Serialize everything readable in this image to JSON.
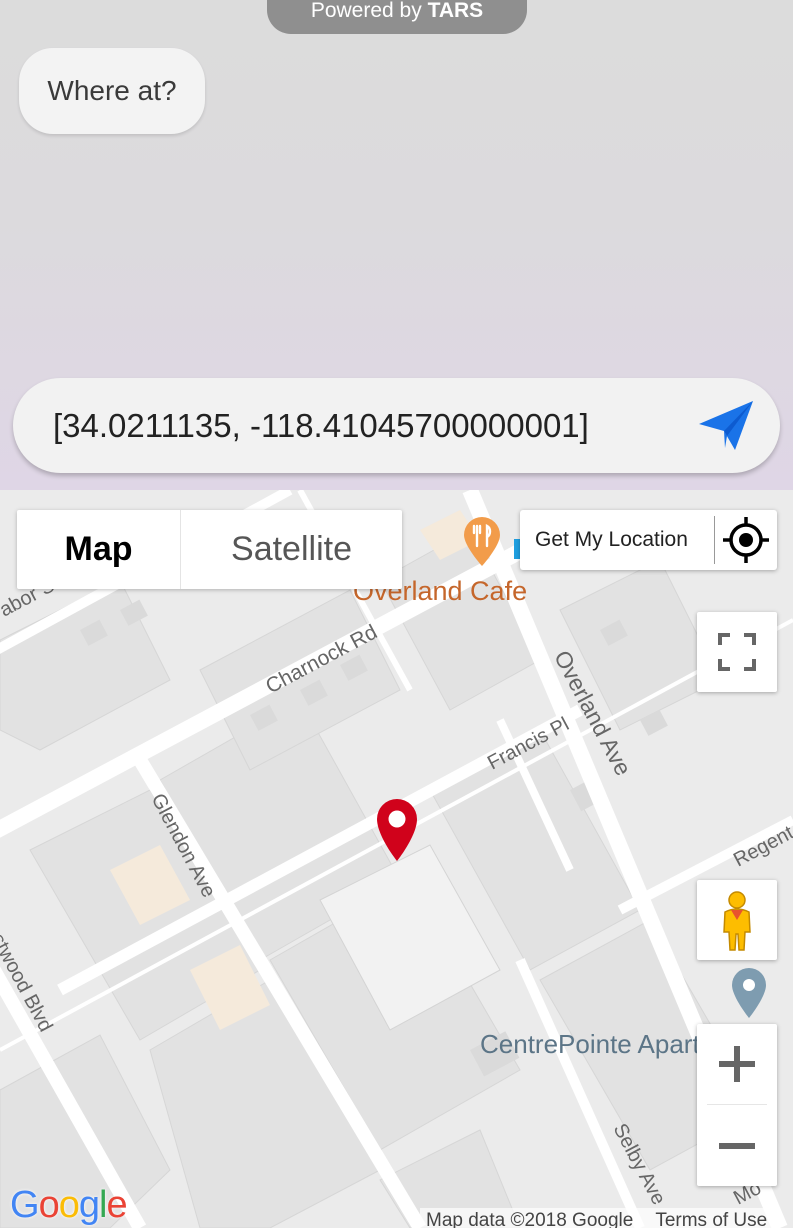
{
  "header": {
    "powered_prefix": "Powered by ",
    "powered_brand": "TARS"
  },
  "chat": {
    "bot_message": "Where at?"
  },
  "composer": {
    "value": "[34.0211135, -118.41045700000001]",
    "send_icon": "send-icon"
  },
  "map": {
    "type_control": {
      "map_label": "Map",
      "satellite_label": "Satellite",
      "selected": "Map"
    },
    "get_location_label": "Get My Location",
    "streets": {
      "tabor": "abor St",
      "charnock": "Charnock Rd",
      "overland": "Overland Ave",
      "francis": "Francis Pl",
      "glendon": "Glendon Ave",
      "regent": "Regent S",
      "westwood": "stwood Blvd",
      "selby": "Selby Ave",
      "mo": "Mo"
    },
    "places": {
      "cafe": "Overland Cafe",
      "apartments": "CentrePointe Apartments"
    },
    "logo": "Google",
    "attribution": {
      "data": "Map data ©2018 Google",
      "terms": "Terms of Use"
    },
    "zoom_in": "+",
    "zoom_out": "−",
    "colors": {
      "marker": "#d0021b",
      "cafe_icon": "#f29c4a",
      "cafe_text": "#c5662b",
      "street_text": "#666666"
    }
  }
}
